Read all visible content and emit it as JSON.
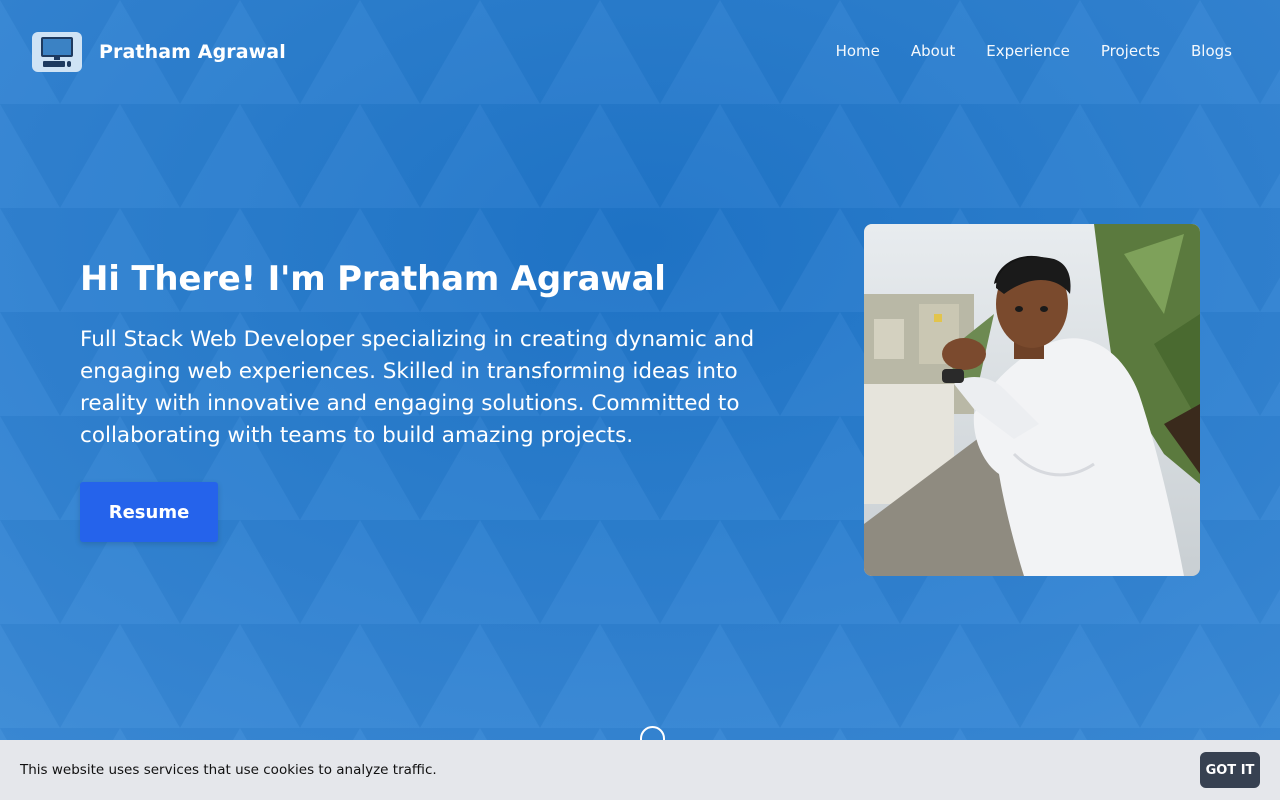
{
  "header": {
    "logo_icon": "computer-icon",
    "site_title": "Pratham Agrawal",
    "nav": [
      {
        "label": "Home"
      },
      {
        "label": "About"
      },
      {
        "label": "Experience"
      },
      {
        "label": "Projects"
      },
      {
        "label": "Blogs"
      }
    ]
  },
  "hero": {
    "title": "Hi There! I'm Pratham Agrawal",
    "description": "Full Stack Web Developer specializing in creating dynamic and engaging web experiences. Skilled in transforming ideas into reality with innovative and engaging solutions. Committed to collaborating with teams to build amazing projects.",
    "resume_label": "Resume",
    "photo_icon": "profile-photo"
  },
  "cookie_banner": {
    "text": "This website uses services that use cookies to analyze traffic.",
    "button_label": "GOT IT"
  },
  "colors": {
    "background": "#2f7fcd",
    "accent_button": "#2563eb",
    "cookie_bg": "#e5e7eb",
    "cookie_button": "#374151"
  }
}
